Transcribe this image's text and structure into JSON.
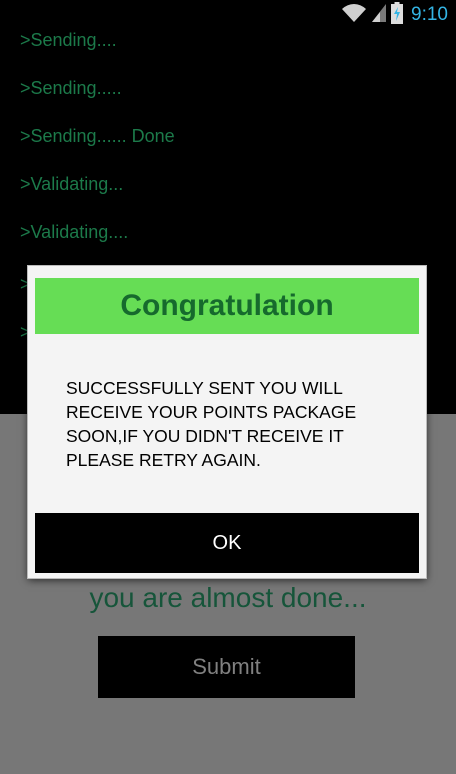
{
  "status_bar": {
    "time": "9:10",
    "icons": [
      "wifi-icon",
      "signal-icon",
      "battery-charging-icon"
    ]
  },
  "console": {
    "lines": [
      ">Sending....",
      ">Sending.....",
      ">Sending...... Done",
      ">Validating...",
      ">Validating....",
      ">",
      ">"
    ]
  },
  "main": {
    "progress_text": "you are almost done...",
    "submit_label": "Submit"
  },
  "dialog": {
    "title": "Congratulation",
    "message": "SUCCESSFULLY SENT YOU WILL RECEIVE YOUR POINTS PACKAGE SOON,IF YOU DIDN'T RECEIVE IT PLEASE RETRY AGAIN.",
    "ok_label": "OK"
  },
  "colors": {
    "console_text": "#1c7a4a",
    "dialog_header": "#66dd55",
    "dialog_title": "#166a2d",
    "status_accent": "#34b5e5"
  }
}
